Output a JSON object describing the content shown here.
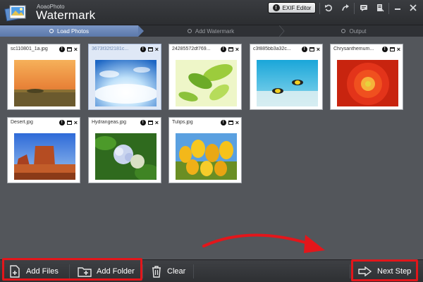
{
  "app": {
    "brand_small": "AoaoPhoto",
    "brand_name": "Watermark"
  },
  "toolbar": {
    "exif_label": "EXIF Editor",
    "icons": [
      "undo-icon",
      "redo-icon",
      "chat-icon",
      "register-icon",
      "minimize-icon",
      "close-icon"
    ]
  },
  "steps": [
    {
      "label": "Load Photos",
      "active": true
    },
    {
      "label": "Add Watermark",
      "active": false
    },
    {
      "label": "Output",
      "active": false
    }
  ],
  "photos": [
    {
      "name": "sc110801_1a.jpg",
      "selected": false,
      "scene": "sunset-field"
    },
    {
      "name": "3673f32f2181c...",
      "selected": true,
      "scene": "sky-fisheye"
    },
    {
      "name": "24285572df769...",
      "selected": false,
      "scene": "green-leaves"
    },
    {
      "name": "c3f885bb3a32c...",
      "selected": false,
      "scene": "underwater-fish"
    },
    {
      "name": "Chrysanthemum...",
      "selected": false,
      "scene": "red-flower"
    },
    {
      "name": "Desert.jpg",
      "selected": false,
      "scene": "desert-rocks"
    },
    {
      "name": "Hydrangeas.jpg",
      "selected": false,
      "scene": "hydrangeas"
    },
    {
      "name": "Tulips.jpg",
      "selected": false,
      "scene": "tulips"
    }
  ],
  "bottom": {
    "add_files": "Add Files",
    "add_folder": "Add Folder",
    "clear": "Clear",
    "next_step": "Next Step"
  },
  "colors": {
    "accent_step": "#6a86b8",
    "highlight_red": "#e3161b",
    "workspace": "#53565b"
  }
}
